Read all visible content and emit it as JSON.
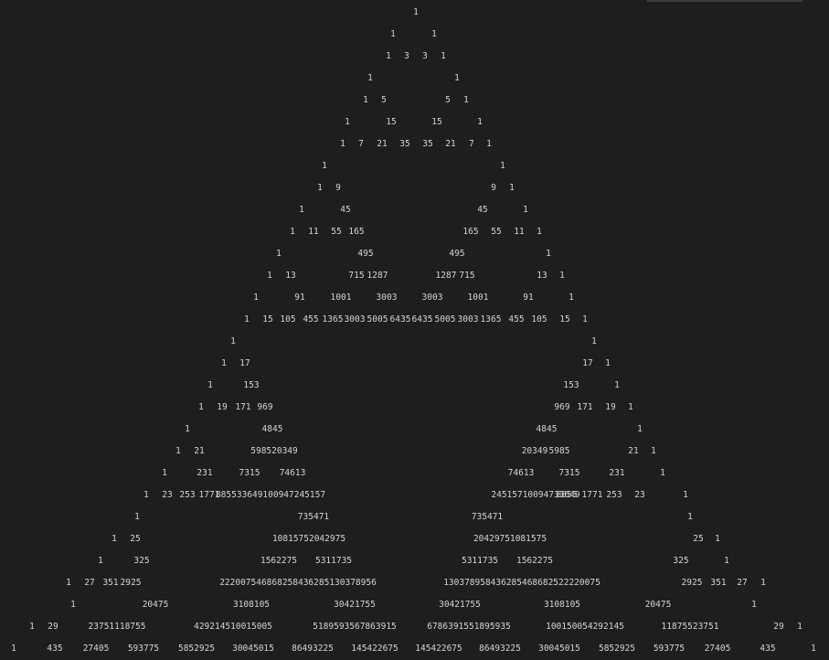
{
  "output": {
    "rows": [
      [
        "1"
      ],
      [
        "1",
        "1"
      ],
      [
        "1",
        "3",
        "3",
        "1"
      ],
      [
        "1",
        "1"
      ],
      [
        "1",
        "5",
        "5",
        "1"
      ],
      [
        "1",
        "15",
        "15",
        "1"
      ],
      [
        "1",
        "7",
        "21",
        "35",
        "35",
        "21",
        "7",
        "1"
      ],
      [
        "1",
        "1"
      ],
      [
        "1",
        "9",
        "9",
        "1"
      ],
      [
        "1",
        "45",
        "45",
        "1"
      ],
      [
        "1",
        "11",
        "55",
        "165",
        "165",
        "55",
        "11",
        "1"
      ],
      [
        "1",
        "495",
        "495",
        "1"
      ],
      [
        "1",
        "13",
        "715",
        "1287",
        "1287",
        "715",
        "13",
        "1"
      ],
      [
        "1",
        "91",
        "1001",
        "3003",
        "3003",
        "1001",
        "91",
        "1"
      ],
      [
        "1",
        "15",
        "105",
        "455",
        "1365",
        "3003",
        "5005",
        "6435",
        "6435",
        "5005",
        "3003",
        "1365",
        "455",
        "105",
        "15",
        "1"
      ],
      [
        "1",
        "1"
      ],
      [
        "1",
        "17",
        "17",
        "1"
      ],
      [
        "1",
        "153",
        "153",
        "1"
      ],
      [
        "1",
        "19",
        "171",
        "969",
        "969",
        "171",
        "19",
        "1"
      ],
      [
        "1",
        "4845",
        "4845",
        "1"
      ],
      [
        "1",
        "21",
        "598520349",
        "20349",
        "5985",
        "21",
        "1"
      ],
      [
        "1",
        "231",
        "7315",
        "74613",
        "74613",
        "7315",
        "231",
        "1"
      ],
      [
        "1",
        "23",
        "253",
        "1771",
        "885533649100947245157",
        "24515710094733649",
        "8855",
        "1771",
        "253",
        "23",
        "1"
      ],
      [
        "1",
        "735471",
        "735471",
        "1"
      ],
      [
        "1",
        "25",
        "10815752042975",
        "20429751081575",
        "25",
        "1"
      ],
      [
        "1",
        "325",
        "1562275",
        "5311735",
        "5311735",
        "1562275",
        "325",
        "1"
      ],
      [
        "1",
        "27",
        "351",
        "2925",
        "222007546868258436285130378956",
        "130378958436285468682522220075",
        "2925",
        "351",
        "27",
        "1"
      ],
      [
        "1",
        "20475",
        "3108105",
        "30421755",
        "30421755",
        "3108105",
        "20475",
        "1"
      ],
      [
        "1",
        "29",
        "23751118755",
        "429214510015005",
        "5189593567863915",
        "6786391551895935",
        "100150054292145",
        "11875523751",
        "29",
        "1"
      ],
      [
        "1",
        "435",
        "27405",
        "593775",
        "5852925",
        "30045015",
        "86493225",
        "145422675",
        "145422675",
        "86493225",
        "30045015",
        "5852925",
        "593775",
        "27405",
        "435",
        "1"
      ]
    ]
  }
}
